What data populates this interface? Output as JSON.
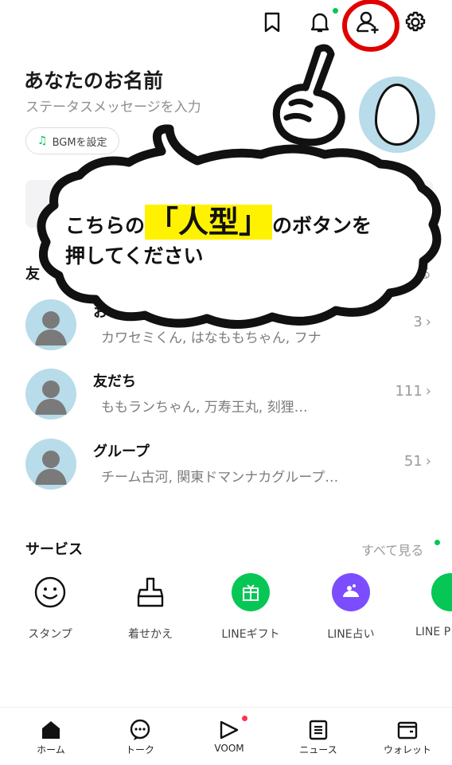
{
  "header": {
    "icons": [
      "bookmark-icon",
      "bell-icon",
      "add-friend-icon",
      "gear-icon"
    ],
    "notification_dot_color": "#06c755"
  },
  "profile": {
    "name": "あなたのお名前",
    "status_placeholder": "ステータスメッセージを入力",
    "bgm_label": "BGMを設定"
  },
  "overlay": {
    "line1_before": "こちらの",
    "line1_highlight": "「人型」",
    "line1_after": "のボタンを",
    "line2": "押してください",
    "highlight_color": "#fff200",
    "circle_color": "#e00000"
  },
  "friends_section": {
    "label": "友",
    "more_fragment": "る"
  },
  "lists": [
    {
      "title": "お",
      "subtitle": "カワセミくん, はなももちゃん, フナ",
      "count": "3"
    },
    {
      "title": "友だち",
      "subtitle": "ももランちゃん,  万寿王丸, 刻狸…",
      "count": "111"
    },
    {
      "title": "グループ",
      "subtitle": "チーム古河, 関東ドマンナカグループ…",
      "count": "51"
    }
  ],
  "services": {
    "title": "サービス",
    "see_all": "すべて見る",
    "items": [
      {
        "label": "スタンプ",
        "icon": "smile-icon"
      },
      {
        "label": "着せかえ",
        "icon": "brush-icon"
      },
      {
        "label": "LINEギフト",
        "icon": "gift-icon"
      },
      {
        "label": "LINE占い",
        "icon": "fortune-icon"
      },
      {
        "label": "LINE P",
        "icon": "pay-icon"
      }
    ],
    "gift_color": "#06c755",
    "fortune_color": "#7b4dff"
  },
  "bottom_nav": [
    {
      "label": "ホーム",
      "icon": "home-icon"
    },
    {
      "label": "トーク",
      "icon": "chat-icon"
    },
    {
      "label": "VOOM",
      "icon": "voom-icon"
    },
    {
      "label": "ニュース",
      "icon": "news-icon"
    },
    {
      "label": "ウォレット",
      "icon": "wallet-icon"
    }
  ]
}
